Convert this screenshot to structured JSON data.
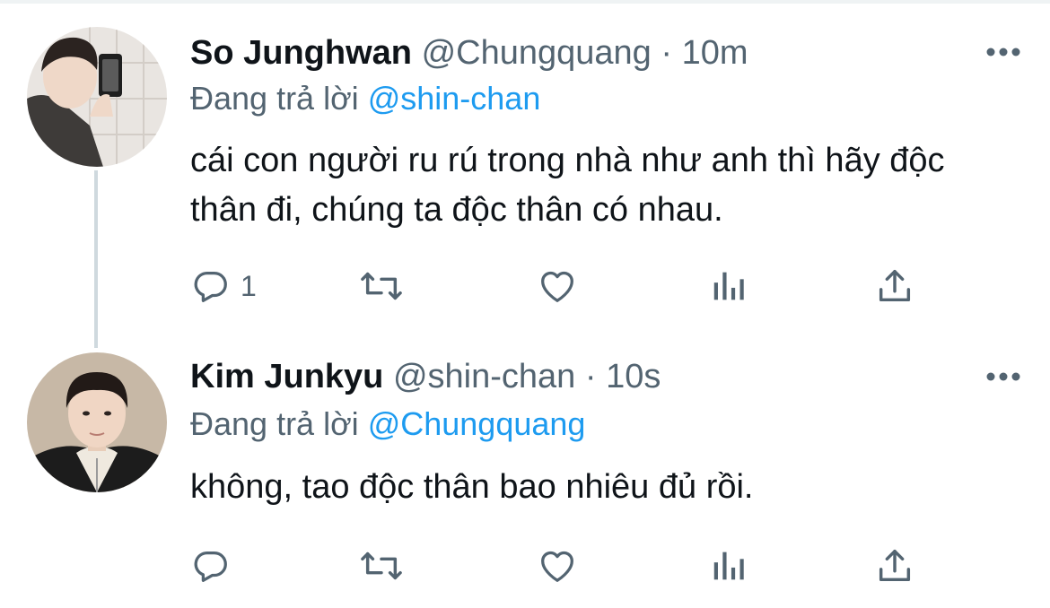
{
  "thread": [
    {
      "display_name": "So Junghwan",
      "handle": "@Chungquang",
      "separator": "·",
      "time": "10m",
      "replying_prefix": "Đang trả lời",
      "replying_to": "@shin-chan",
      "text": "cái con người ru rú trong nhà như anh thì hãy độc thân đi, chúng ta độc thân có nhau.",
      "reply_count": "1",
      "avatar_icon": "avatar-photo"
    },
    {
      "display_name": "Kim Junkyu",
      "handle": "@shin-chan",
      "separator": "·",
      "time": "10s",
      "replying_prefix": "Đang trả lời",
      "replying_to": "@Chungquang",
      "text": "không, tao độc thân bao nhiêu đủ rồi.",
      "reply_count": "",
      "avatar_icon": "avatar-photo"
    }
  ],
  "icons": {
    "reply": "reply-icon",
    "retweet": "retweet-icon",
    "like": "heart-icon",
    "views": "bar-chart-icon",
    "share": "share-icon",
    "more": "more-icon"
  },
  "colors": {
    "text_primary": "#0f1419",
    "text_secondary": "#536471",
    "link": "#1d9bf0",
    "thread_line": "#cfd9de"
  }
}
